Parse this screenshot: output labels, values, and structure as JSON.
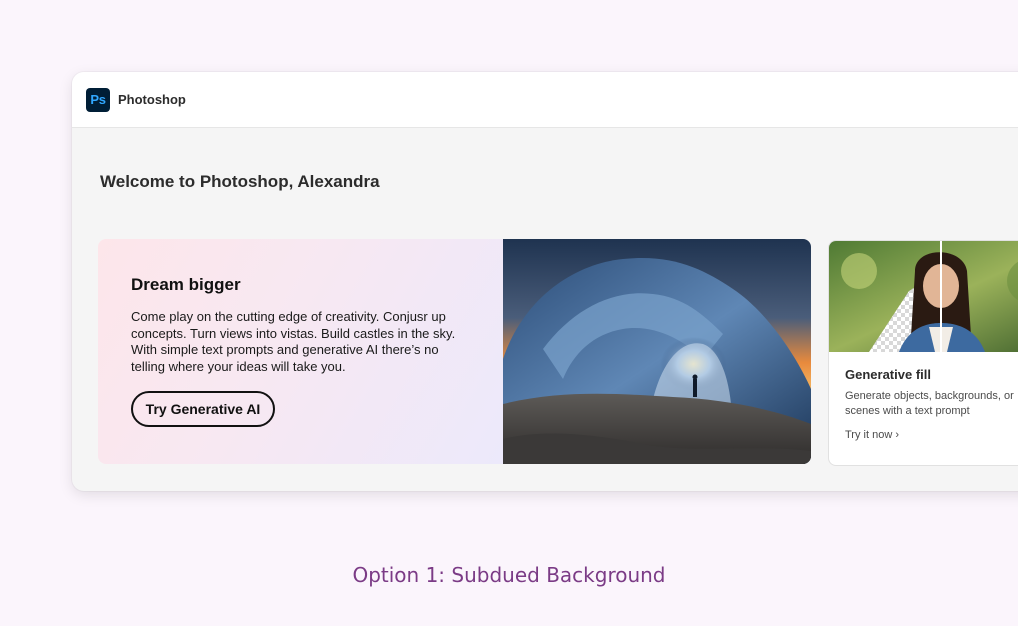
{
  "app": {
    "name": "Photoshop",
    "logo_text": "Ps",
    "logo_bg": "#001e36",
    "logo_fg": "#31a8ff"
  },
  "main": {
    "welcome": "Welcome to Photoshop, Alexandra"
  },
  "hero": {
    "title": "Dream bigger",
    "description": "Come play on the cutting edge of creativity. Conjusr up concepts. Turn views into vistas. Build castles in the sky. With simple text prompts and generative AI there’s no telling where your ideas will take you.",
    "cta_label": "Try Generative AI",
    "image_icon": "ice-cave-photo"
  },
  "card": {
    "title": "Generative fill",
    "description": "Generate objects, backgrounds, or scenes with a text prompt",
    "link_label": "Try it now",
    "link_icon": "chevron-right-icon",
    "image_icon": "portrait-photo"
  },
  "caption": "Option 1: Subdued Background"
}
